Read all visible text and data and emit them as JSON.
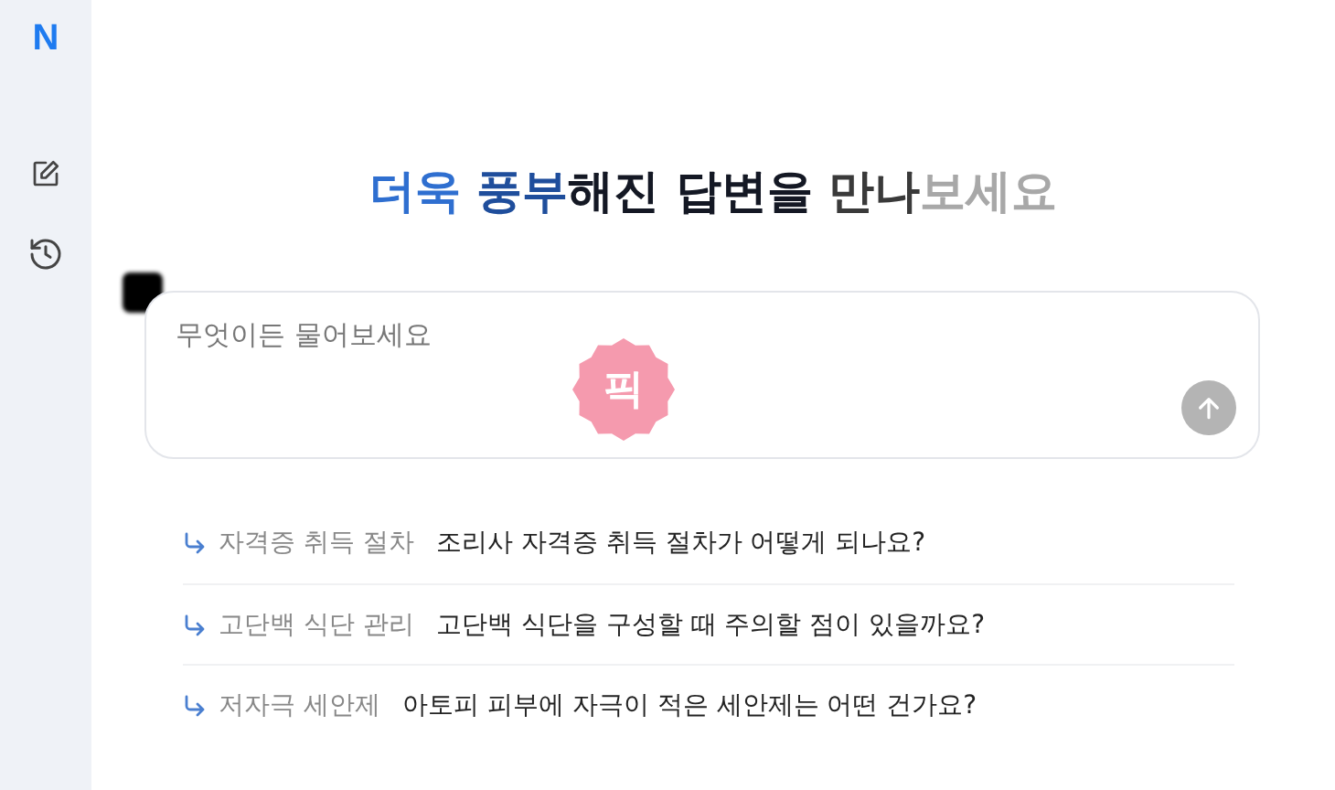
{
  "sidebar": {
    "logo": "N",
    "items": [
      {
        "kind": "compose"
      },
      {
        "kind": "history"
      }
    ]
  },
  "headline": [
    {
      "text": "더욱",
      "color": "#2f6fd0"
    },
    {
      "text": "풍부",
      "color": "#1f4e9c"
    },
    {
      "text": "해진 답변을",
      "color": "#141824"
    },
    {
      "text": "만나",
      "color": "#3a3a3a"
    },
    {
      "text": "보세요",
      "color": "#a8a8a8"
    }
  ],
  "prompt": {
    "placeholder": "무엇이든 물어보세요",
    "badge": "픽",
    "send_disabled": true
  },
  "suggestions": [
    {
      "topic": "자격증 취득 절차",
      "question": "조리사 자격증 취득 절차가 어떻게 되나요?"
    },
    {
      "topic": "고단백 식단 관리",
      "question": "고단백 식단을 구성할 때 주의할 점이 있을까요?"
    },
    {
      "topic": "저자극 세안제",
      "question": "아토피 피부에 자극이 적은 세안제는 어떤 건가요?"
    }
  ]
}
